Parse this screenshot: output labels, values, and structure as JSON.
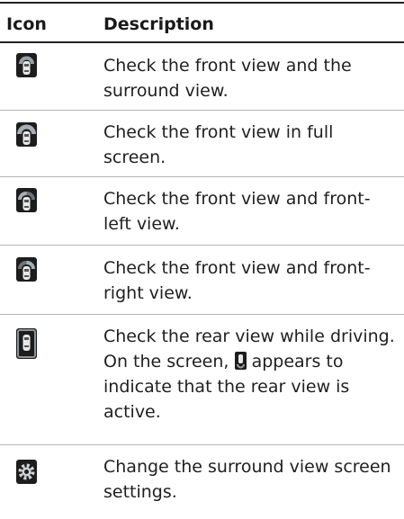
{
  "table": {
    "headers": {
      "icon": "Icon",
      "description": "Description"
    },
    "rows": [
      {
        "icon": "front-and-surround-view-icon",
        "description": "Check the front view and the surround view."
      },
      {
        "icon": "front-full-screen-view-icon",
        "description": "Check the front view in full screen."
      },
      {
        "icon": "front-left-view-icon",
        "description": "Check the front view and front-left view."
      },
      {
        "icon": "front-right-view-icon",
        "description": "Check the front view and front-right view."
      },
      {
        "icon": "rear-view-icon",
        "description_before": "Check the rear view while driving. On the screen,",
        "inline_icon": "rear-view-active-indicator-icon",
        "description_after": "appears to indicate that the rear view is active."
      },
      {
        "icon": "settings-gear-icon",
        "description": "Change the surround view screen settings."
      }
    ]
  }
}
